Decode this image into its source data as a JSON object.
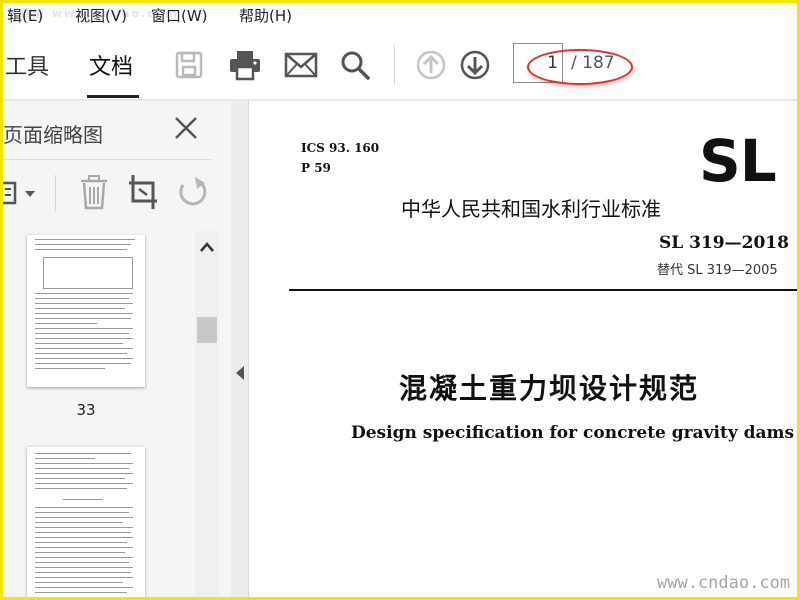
{
  "menu": {
    "items": [
      "辑(E)",
      "视图(V)",
      "窗口(W)",
      "帮助(H)"
    ],
    "watermark": "下载道 www.cndao.com"
  },
  "toolbar": {
    "tab_tools": "工具",
    "tab_document": "文档",
    "icons": [
      "save-icon",
      "print-icon",
      "mail-icon",
      "search-icon",
      "arrow-up-icon",
      "arrow-down-icon"
    ],
    "page_current": "1",
    "page_total": "/ 187",
    "accent": "#e03030"
  },
  "side_panel": {
    "title": "页面缩略图",
    "tools": [
      "view-options-icon",
      "delete-icon",
      "crop-icon",
      "rotate-icon"
    ],
    "thumbnails": [
      {
        "label": "33"
      },
      {
        "label": ""
      }
    ]
  },
  "document": {
    "ics": "ICS 93. 160",
    "p_code": "P 59",
    "logo": "SL",
    "standard_cn": "中华人民共和国水利行业标准",
    "standard_no": "SL 319—2018",
    "replaces": "替代 SL 319—2005",
    "title_cn": "混凝土重力坝设计规范",
    "title_en": "Design specification for concrete gravity dams",
    "site_mark": "www.cndao.com"
  }
}
